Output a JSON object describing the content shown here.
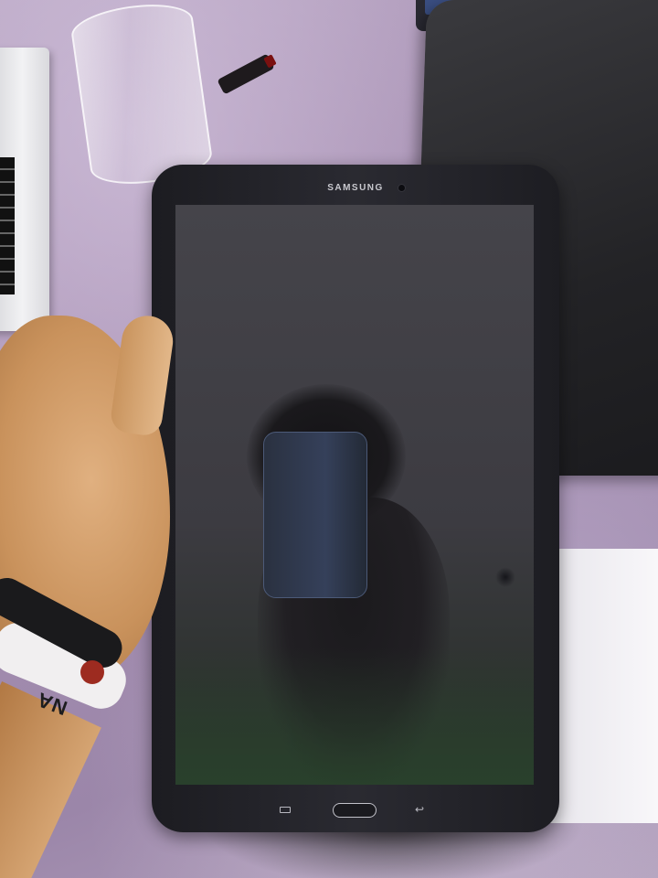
{
  "photo": {
    "device_brand": "SAMSUNG",
    "wristband_text": "NA",
    "icons": [
      "recent-apps-icon",
      "home-button-icon",
      "back-icon",
      "front-camera-icon"
    ],
    "colors": {
      "tablecloth": "#a58fb0",
      "tablet_body": "#232328",
      "screen": "#3f3e44",
      "phone_reflection": "#35405a",
      "wristband_accent": "#9d2b20"
    }
  }
}
